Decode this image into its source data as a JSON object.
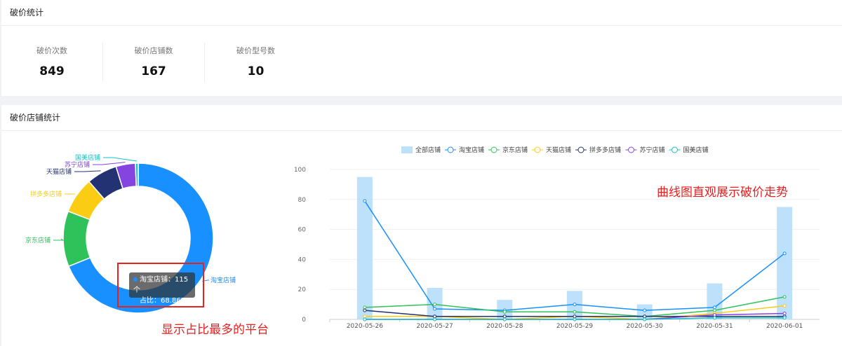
{
  "summary": {
    "title": "破价统计",
    "stats": [
      {
        "label": "破价次数",
        "value": "849"
      },
      {
        "label": "破价店铺数",
        "value": "167"
      },
      {
        "label": "破价型号数",
        "value": "10"
      }
    ]
  },
  "shops": {
    "title": "破价店铺统计",
    "tooltip": {
      "line1": "淘宝店铺：115个",
      "line2": "占比：68.86%"
    },
    "annotation_pie": "显示占比最多的平台",
    "annotation_line": "曲线图直观展示破价走势"
  },
  "chart_data": [
    {
      "type": "pie",
      "series": [
        {
          "name": "淘宝店铺",
          "value": 115,
          "color": "#1890ff"
        },
        {
          "name": "京东店铺",
          "value": 20,
          "color": "#2fc25b"
        },
        {
          "name": "拼多多店铺",
          "value": 13,
          "color": "#facc14"
        },
        {
          "name": "天猫店铺",
          "value": 11,
          "color": "#223273"
        },
        {
          "name": "苏宁店铺",
          "value": 7,
          "color": "#8543e0"
        },
        {
          "name": "国美店铺",
          "value": 1,
          "color": "#13c2c2"
        }
      ]
    },
    {
      "type": "line",
      "categories": [
        "2020-05-26",
        "2020-05-27",
        "2020-05-28",
        "2020-05-29",
        "2020-05-30",
        "2020-05-31",
        "2020-06-01"
      ],
      "ylim": [
        0,
        100
      ],
      "yticks": [
        "0",
        "20",
        "40",
        "60",
        "80",
        "100"
      ],
      "legend": "top",
      "grid": true,
      "series": [
        {
          "name": "全部店铺",
          "kind": "bar",
          "color": "#bde0fb",
          "values": [
            95,
            21,
            13,
            19,
            10,
            24,
            75
          ]
        },
        {
          "name": "淘宝店铺",
          "color": "#1890ff",
          "values": [
            79,
            7,
            6,
            10,
            6,
            8,
            44
          ]
        },
        {
          "name": "京东店铺",
          "color": "#2fc25b",
          "values": [
            8,
            10,
            5,
            5,
            2,
            6,
            15
          ]
        },
        {
          "name": "天猫店铺",
          "color": "#facc14",
          "values": [
            2,
            2,
            0,
            2,
            0,
            4,
            9
          ]
        },
        {
          "name": "拼多多店铺",
          "color": "#223273",
          "values": [
            6,
            2,
            2,
            2,
            2,
            2,
            2
          ]
        },
        {
          "name": "苏宁店铺",
          "color": "#8543e0",
          "values": [
            0,
            0,
            0,
            0,
            0,
            3,
            4
          ]
        },
        {
          "name": "国美店铺",
          "color": "#13c2c2",
          "values": [
            0,
            0,
            0,
            0,
            0,
            1,
            1
          ]
        }
      ]
    }
  ]
}
